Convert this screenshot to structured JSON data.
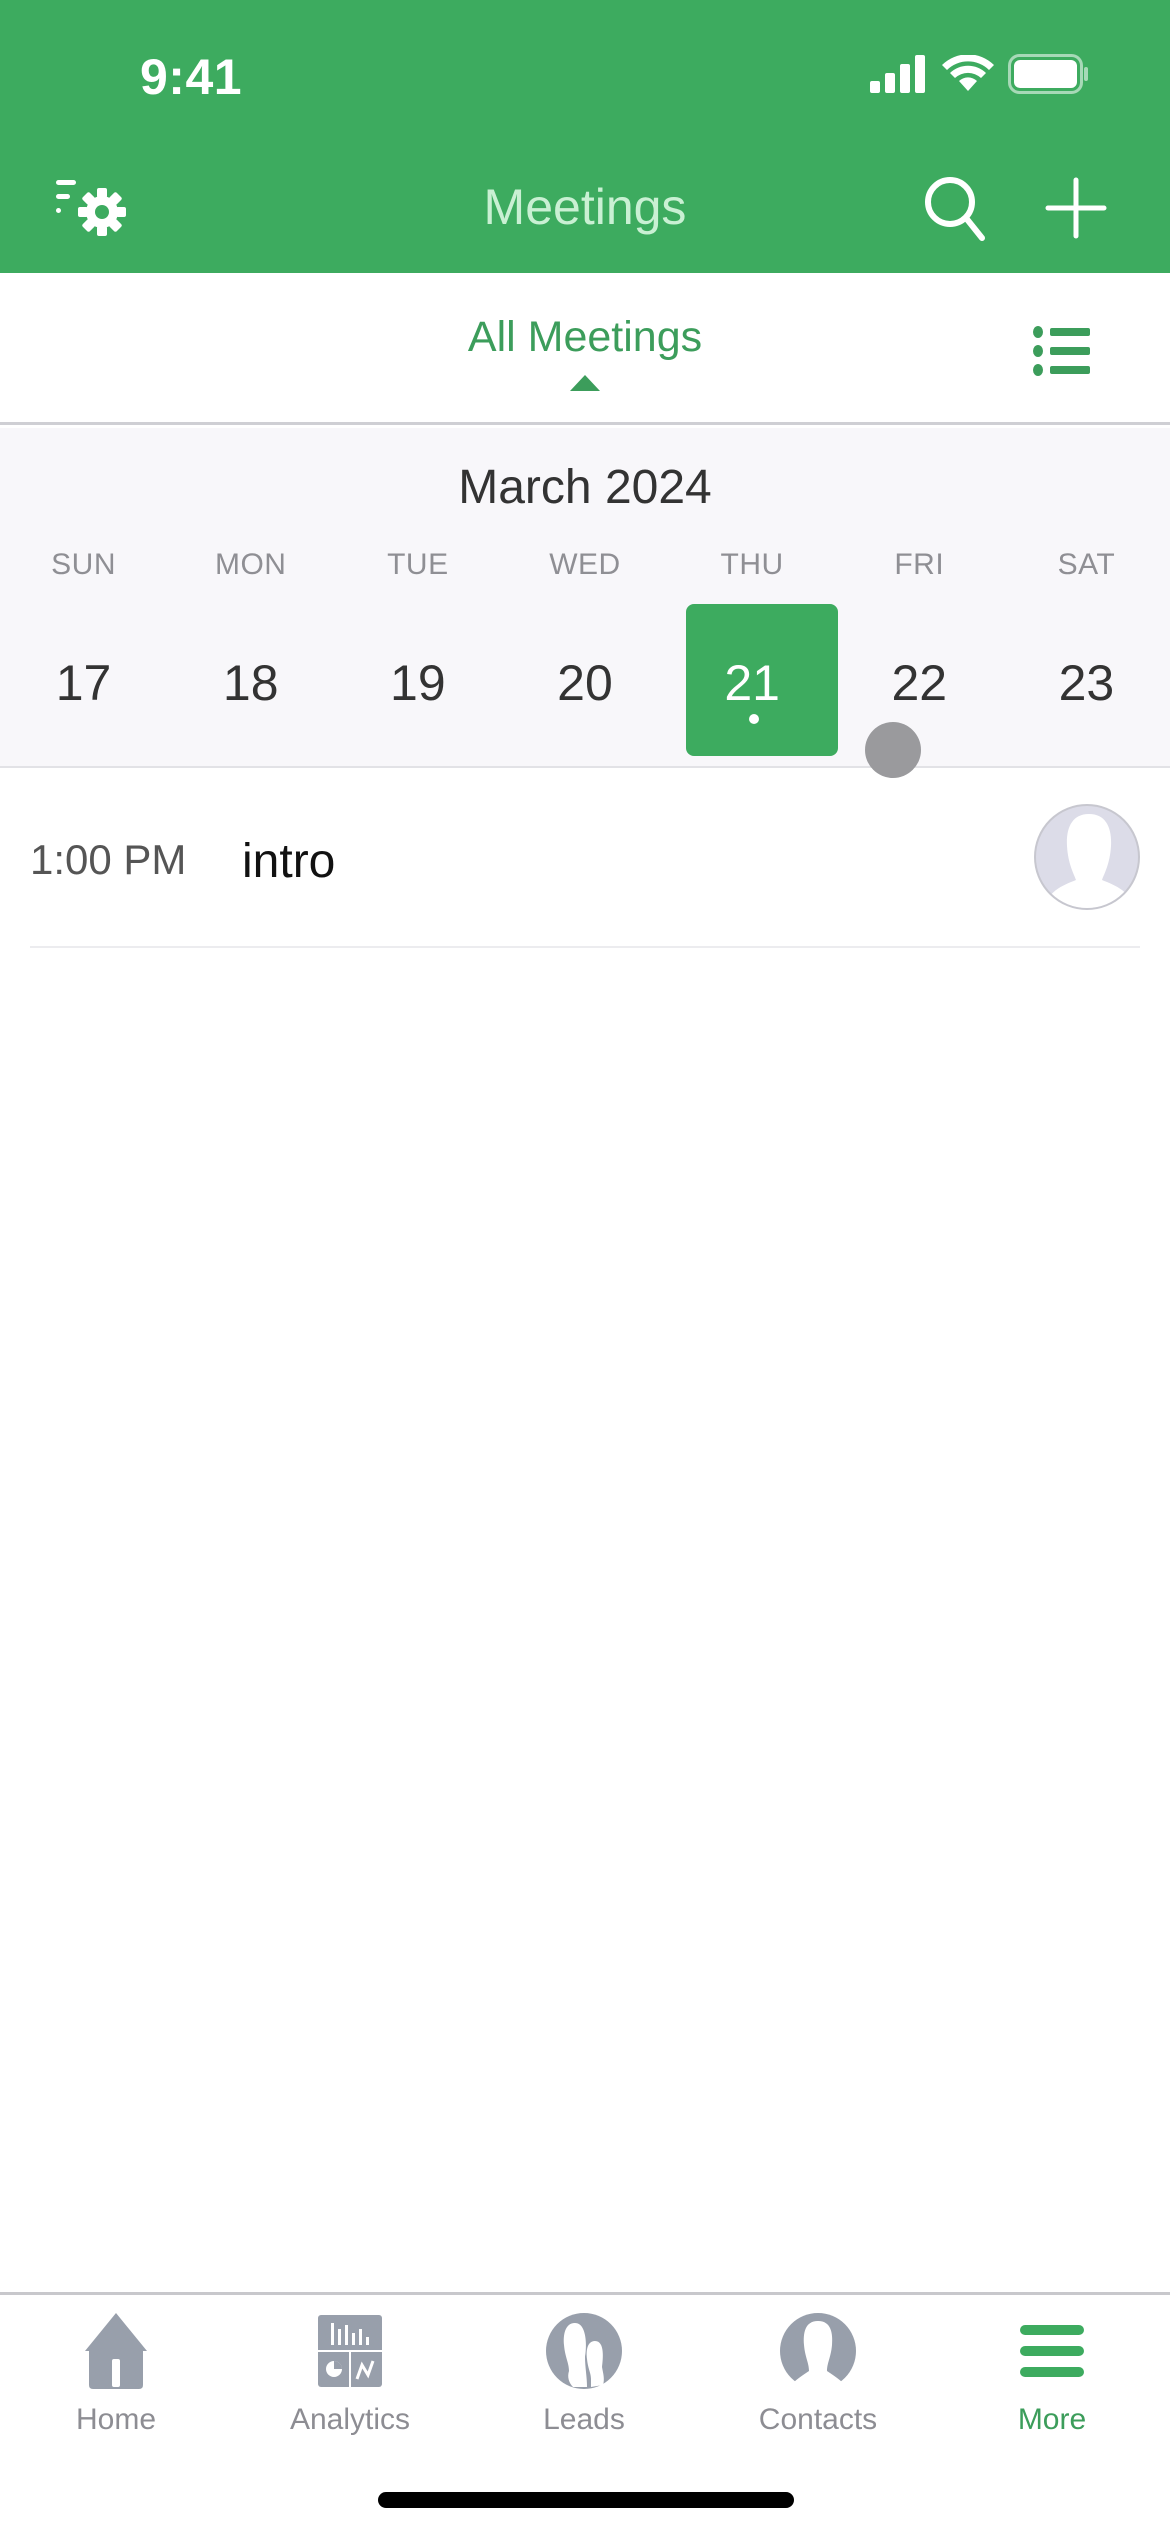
{
  "status_bar": {
    "time": "9:41"
  },
  "nav": {
    "title": "Meetings",
    "left_icon": "filter-settings-icon",
    "right_icons": [
      "search-icon",
      "plus-icon"
    ]
  },
  "segment": {
    "title": "All Meetings",
    "view_icon": "list-icon"
  },
  "calendar": {
    "month": "March 2024",
    "weekdays": [
      "SUN",
      "MON",
      "TUE",
      "WED",
      "THU",
      "FRI",
      "SAT"
    ],
    "days": [
      "17",
      "18",
      "19",
      "20",
      "21",
      "22",
      "23"
    ],
    "selected_day": "21"
  },
  "meetings": [
    {
      "time": "1:00 PM",
      "title": "intro"
    }
  ],
  "tabbar": {
    "items": [
      {
        "label": "Home",
        "icon": "home-icon"
      },
      {
        "label": "Analytics",
        "icon": "analytics-icon"
      },
      {
        "label": "Leads",
        "icon": "leads-icon"
      },
      {
        "label": "Contacts",
        "icon": "contacts-icon"
      },
      {
        "label": "More",
        "icon": "menu-icon",
        "active": true
      }
    ]
  },
  "colors": {
    "brand": "#3dab5f",
    "accent_text": "#3c9d5b",
    "inactive": "#8d8d93"
  }
}
